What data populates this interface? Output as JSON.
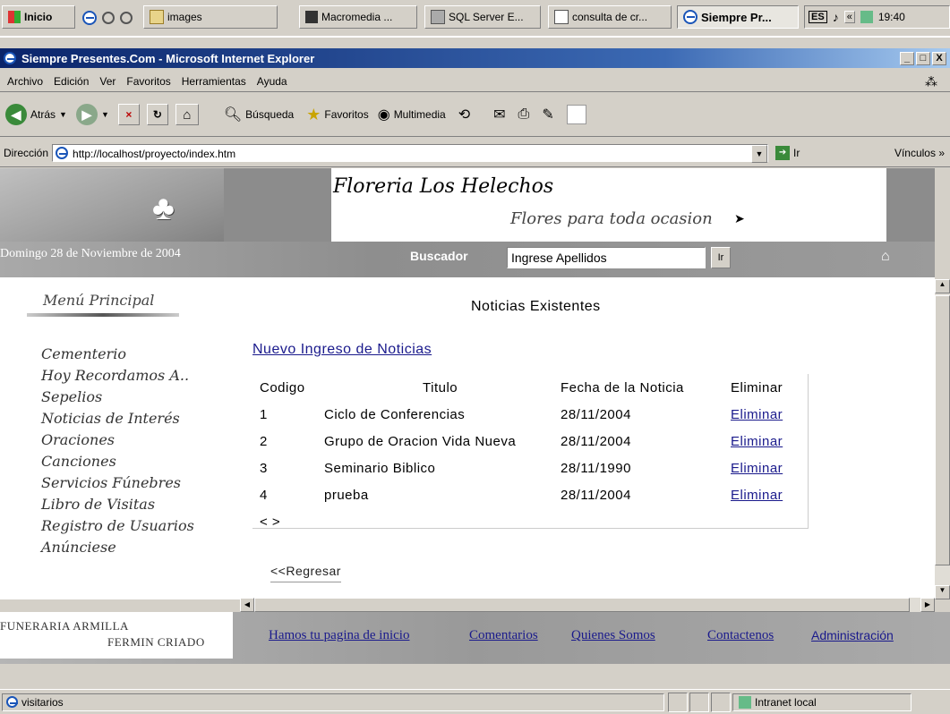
{
  "taskbar": {
    "start_label": "Inicio",
    "items": [
      {
        "label": "images"
      },
      {
        "label": "Macromedia ..."
      },
      {
        "label": "SQL Server E..."
      },
      {
        "label": "consulta de cr..."
      },
      {
        "label": "Siempre Pr..."
      }
    ],
    "lang": "ES",
    "clock": "19:40"
  },
  "window": {
    "title": "Siempre Presentes.Com - Microsoft Internet Explorer",
    "controls": {
      "minimize": "_",
      "maximize": "□",
      "close": "X"
    }
  },
  "menu": [
    "Archivo",
    "Edición",
    "Ver",
    "Favoritos",
    "Herramientas",
    "Ayuda"
  ],
  "toolbar": {
    "back": "Atrás",
    "search": "Búsqueda",
    "favorites": "Favoritos",
    "multimedia": "Multimedia"
  },
  "address": {
    "label": "Dirección",
    "url": "http://localhost/proyecto/index.htm",
    "go": "Ir",
    "links": "Vínculos"
  },
  "page": {
    "banner_title": "Floreria Los Helechos",
    "banner_subtitle": "Flores para toda ocasion",
    "date": "Domingo 28 de Noviembre de 2004",
    "search_label": "Buscador",
    "search_value": "Ingrese Apellidos",
    "search_button": "Ir",
    "menu_title": "Menú Principal",
    "menu_items": [
      "Cementerio",
      "Hoy Recordamos A..",
      "Sepelios",
      "Noticias de Interés",
      "Oraciones",
      "Canciones",
      "Servicios Fúnebres",
      "Libro de Visitas",
      "Registro de Usuarios",
      "Anúnciese"
    ],
    "section_title": "Noticias Existentes",
    "new_link": "Nuevo Ingreso de Noticias",
    "table": {
      "headers": [
        "Codigo",
        "Titulo",
        "Fecha de la Noticia",
        "Eliminar"
      ],
      "rows": [
        {
          "codigo": "1",
          "titulo": "Ciclo de Conferencias",
          "fecha": "28/11/2004",
          "accion": "Eliminar"
        },
        {
          "codigo": "2",
          "titulo": "Grupo de Oracion Vida Nueva",
          "fecha": "28/11/2004",
          "accion": "Eliminar"
        },
        {
          "codigo": "3",
          "titulo": "Seminario Biblico",
          "fecha": "28/11/1990",
          "accion": "Eliminar"
        },
        {
          "codigo": "4",
          "titulo": "prueba",
          "fecha": "28/11/2004",
          "accion": "Eliminar"
        }
      ],
      "pager": "< >"
    },
    "back_link": "<<Regresar",
    "footer_brand_line1": "FUNERARIA ARMILLA",
    "footer_brand_line2": "FERMIN CRIADO",
    "footer_links": [
      "Hamos tu pagina de inicio",
      "Comentarios",
      "Quienes Somos",
      "Contactenos",
      "Administración"
    ]
  },
  "status": {
    "text": "visitarios",
    "zone": "Intranet local"
  }
}
